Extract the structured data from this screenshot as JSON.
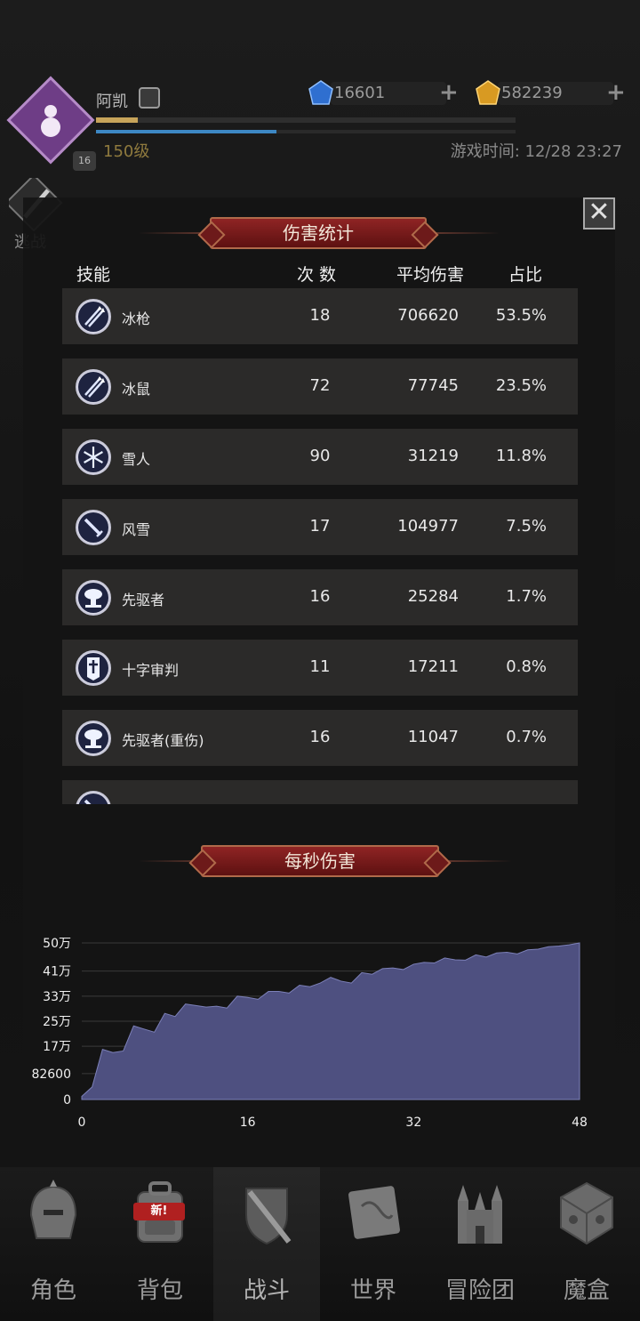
{
  "player": {
    "name": "阿凯",
    "level": "150级",
    "badge_level": "16",
    "xp_progress": 0.1,
    "mp_progress": 0.43
  },
  "currencies": [
    {
      "icon": "blue-gem-icon",
      "value": "16601"
    },
    {
      "icon": "gold-gem-icon",
      "value": "582239"
    }
  ],
  "game_time": "游戏时间: 12/28 23:27",
  "side_tab": {
    "label": "逃战"
  },
  "damage_stats": {
    "title": "伤害统计",
    "headers": {
      "skill": "技能",
      "count": "次 数",
      "avg": "平均伤害",
      "pct": "占比"
    },
    "rows": [
      {
        "icon": "ice-spear-icon",
        "name": "冰枪",
        "count": "18",
        "avg": "706620",
        "pct": "53.5%"
      },
      {
        "icon": "ice-spear-icon",
        "name": "冰鼠",
        "count": "72",
        "avg": "77745",
        "pct": "23.5%"
      },
      {
        "icon": "snowflake-icon",
        "name": "雪人",
        "count": "90",
        "avg": "31219",
        "pct": "11.8%"
      },
      {
        "icon": "sword-icon",
        "name": "风雪",
        "count": "17",
        "avg": "104977",
        "pct": "7.5%"
      },
      {
        "icon": "mushroom-cloud-icon",
        "name": "先驱者",
        "count": "16",
        "avg": "25284",
        "pct": "1.7%"
      },
      {
        "icon": "cross-banner-icon",
        "name": "十字审判",
        "count": "11",
        "avg": "17211",
        "pct": "0.8%"
      },
      {
        "icon": "mushroom-cloud-icon",
        "name": "先驱者(重伤)",
        "count": "16",
        "avg": "11047",
        "pct": "0.7%"
      },
      {
        "icon": "sword-icon",
        "name": "",
        "count": "",
        "avg": "",
        "pct": ""
      }
    ]
  },
  "chart_data": {
    "type": "area",
    "title": "每秒伤害",
    "xlabel": "",
    "ylabel": "",
    "xlim": [
      0,
      48
    ],
    "ylim": [
      0,
      500000
    ],
    "x_ticks": [
      "0",
      "16",
      "32",
      "48"
    ],
    "y_ticks": [
      "0",
      "82600",
      "17万",
      "25万",
      "33万",
      "41万",
      "50万"
    ],
    "y_tick_values": [
      0,
      82600,
      170000,
      250000,
      330000,
      410000,
      500000
    ],
    "grid": true,
    "color": "#4e5080",
    "x": [
      0,
      1,
      2,
      3,
      4,
      5,
      6,
      7,
      8,
      9,
      10,
      11,
      12,
      13,
      14,
      15,
      16,
      17,
      18,
      19,
      20,
      21,
      22,
      23,
      24,
      25,
      26,
      27,
      28,
      29,
      30,
      31,
      32,
      33,
      34,
      35,
      36,
      37,
      38,
      39,
      40,
      41,
      42,
      43,
      44,
      45,
      46,
      47,
      48
    ],
    "values": [
      10000,
      40000,
      160000,
      150000,
      155000,
      235000,
      225000,
      215000,
      275000,
      265000,
      305000,
      300000,
      295000,
      298000,
      292000,
      330000,
      326000,
      320000,
      345000,
      345000,
      340000,
      365000,
      360000,
      372000,
      390000,
      378000,
      372000,
      405000,
      400000,
      418000,
      420000,
      415000,
      432000,
      438000,
      436000,
      452000,
      446000,
      445000,
      462000,
      455000,
      468000,
      470000,
      465000,
      478000,
      480000,
      488000,
      490000,
      494000,
      500000
    ]
  },
  "nav": {
    "items": [
      {
        "label": "角色",
        "icon": "helmet-icon"
      },
      {
        "label": "背包",
        "icon": "backpack-icon",
        "badge": "新!"
      },
      {
        "label": "战斗",
        "icon": "sword-shield-icon",
        "active": true
      },
      {
        "label": "世界",
        "icon": "map-scroll-icon"
      },
      {
        "label": "冒险团",
        "icon": "castle-icon"
      },
      {
        "label": "魔盒",
        "icon": "magic-cube-icon"
      }
    ]
  }
}
